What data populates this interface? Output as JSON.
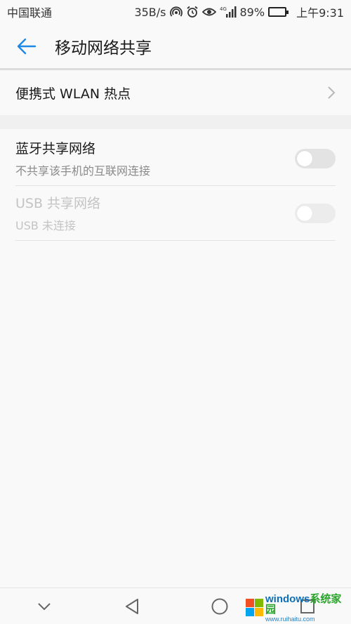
{
  "status_bar": {
    "carrier": "中国联通",
    "net_speed": "35B/s",
    "signal_type": "4G",
    "battery": "89%",
    "battery_level": 0.89,
    "time": "上午9:31",
    "icons": [
      "hotspot-icon",
      "alarm-icon",
      "eye-comfort-icon",
      "signal-icon",
      "battery-icon"
    ]
  },
  "header": {
    "title": "移动网络共享",
    "accent": "#1e88e5"
  },
  "hotspot_row": {
    "label": "便携式 WLAN 热点"
  },
  "bluetooth_row": {
    "title": "蓝牙共享网络",
    "subtitle": "不共享该手机的互联网连接",
    "enabled": false
  },
  "usb_row": {
    "title": "USB 共享网络",
    "subtitle": "USB 未连接",
    "enabled": false,
    "disabled": true
  },
  "nav_bar": {
    "buttons": [
      "collapse-icon",
      "back-triangle-icon",
      "home-circle-icon",
      "recent-square-icon"
    ]
  },
  "watermark": {
    "main_prefix": "windows",
    "main_suffix": "系统家园",
    "url": "www.ruihaitu.com"
  }
}
